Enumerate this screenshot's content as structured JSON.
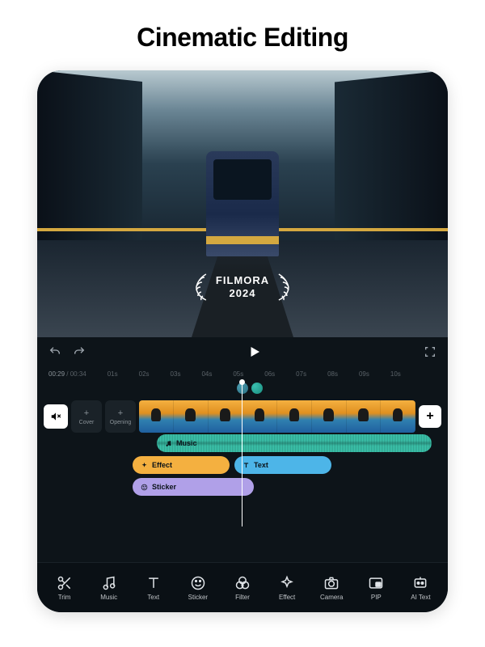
{
  "header": {
    "title": "Cinematic Editing"
  },
  "preview": {
    "badge_line1": "FILMORA",
    "badge_line2": "2024"
  },
  "controls": {
    "undo_name": "undo",
    "redo_name": "redo",
    "play_name": "play",
    "fullscreen_name": "fullscreen"
  },
  "ruler": {
    "current": "00:29",
    "total": "00:34",
    "ticks": [
      "01s",
      "02s",
      "03s",
      "04s",
      "05s",
      "06s",
      "07s",
      "08s",
      "09s",
      "10s"
    ]
  },
  "timeline": {
    "cover_label": "Cover",
    "opening_label": "Opening",
    "add_label": "+",
    "clip_frames": 8
  },
  "tracks": {
    "music": "Music",
    "effect": "Effect",
    "text": "Text",
    "sticker": "Sticker"
  },
  "toolbar": [
    {
      "id": "trim",
      "label": "Trim",
      "icon": "scissors"
    },
    {
      "id": "music",
      "label": "Music",
      "icon": "note"
    },
    {
      "id": "text",
      "label": "Text",
      "icon": "T"
    },
    {
      "id": "sticker",
      "label": "Sticker",
      "icon": "smile"
    },
    {
      "id": "filter",
      "label": "Filter",
      "icon": "circles"
    },
    {
      "id": "effect",
      "label": "Effect",
      "icon": "sparkle"
    },
    {
      "id": "camera",
      "label": "Camera",
      "icon": "camera"
    },
    {
      "id": "pip",
      "label": "PIP",
      "icon": "pip"
    },
    {
      "id": "aitext",
      "label": "AI Text",
      "icon": "ai"
    }
  ]
}
